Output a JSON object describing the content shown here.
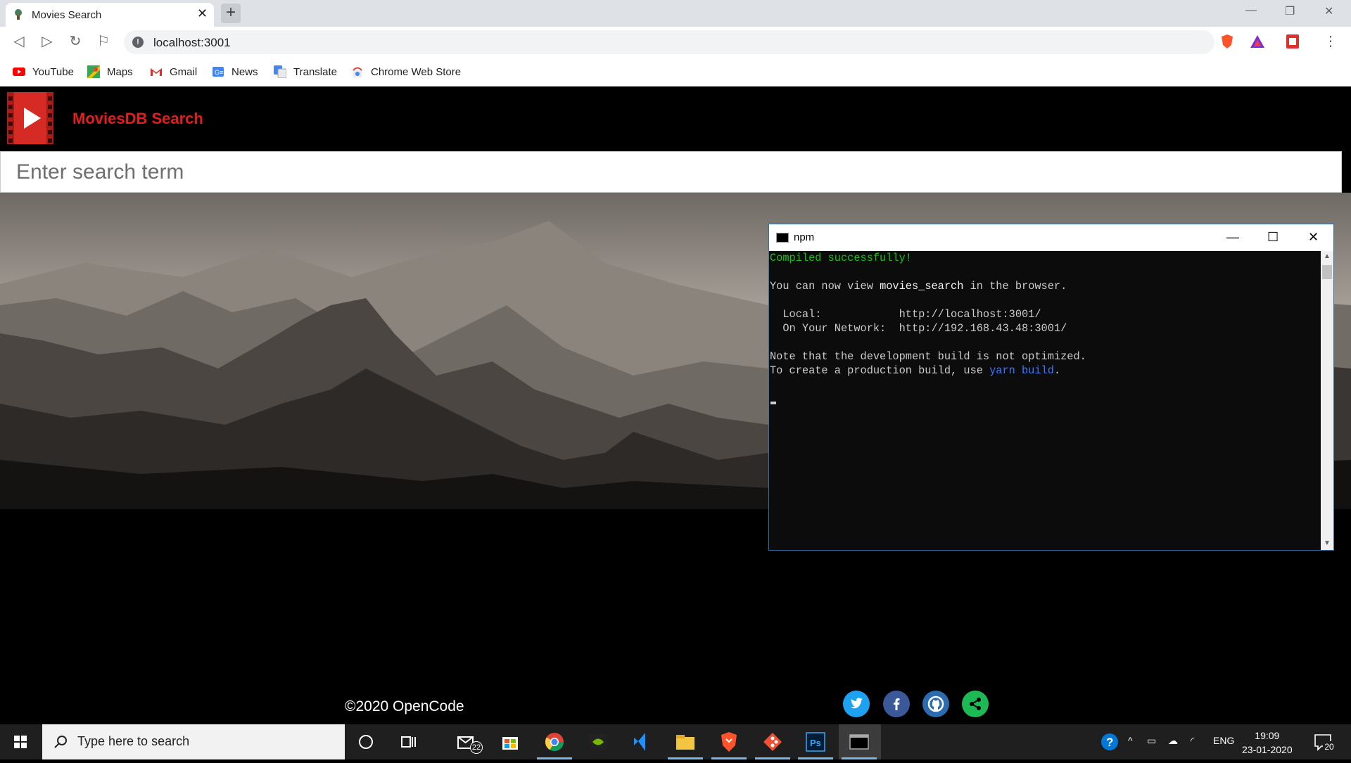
{
  "browser": {
    "tab_title": "Movies Search",
    "url": "localhost:3001",
    "bookmarks": [
      "YouTube",
      "Maps",
      "Gmail",
      "News",
      "Translate",
      "Chrome Web Store"
    ]
  },
  "app": {
    "brand": "MoviesDB Search",
    "search_placeholder": "Enter search term",
    "footer": "©2020 OpenCode",
    "social": [
      "twitter-icon",
      "facebook-icon",
      "github-icon",
      "share-icon"
    ],
    "colors": {
      "brand": "#e31c1c",
      "twitter": "#1da1f2",
      "facebook": "#3b5998",
      "github": "#2b6cb0",
      "share": "#1db954"
    }
  },
  "console": {
    "title": "npm",
    "lines": {
      "compiled": "Compiled successfully!",
      "view_prefix": "You can now view ",
      "view_app": "movies_search",
      "view_suffix": " in the browser.",
      "local_label": "  Local:            ",
      "local_url": "http://localhost:3001/",
      "network_label": "  On Your Network:  ",
      "network_url": "http://192.168.43.48:3001/",
      "note": "Note that the development build is not optimized.",
      "prod_prefix": "To create a production build, use ",
      "prod_cmd": "yarn build",
      "prod_suffix": "."
    }
  },
  "taskbar": {
    "search_placeholder": "Type here to search",
    "mail_badge": "22",
    "language": "ENG",
    "time": "19:09",
    "date": "23-01-2020",
    "notifications": "20"
  }
}
